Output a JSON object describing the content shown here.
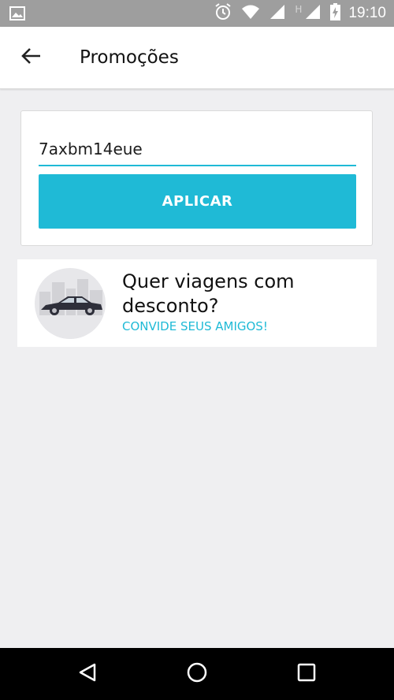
{
  "status_bar": {
    "time": "19:10",
    "network_label": "H",
    "icons": [
      "image-icon",
      "alarm-icon",
      "wifi-icon",
      "signal-icon",
      "signal-icon",
      "battery-charging-icon"
    ]
  },
  "header": {
    "title": "Promoções",
    "back_icon": "arrow-left-icon"
  },
  "promo": {
    "code_value": "7axbm14eue",
    "apply_label": "APLICAR"
  },
  "invite": {
    "heading": "Quer viagens com desconto?",
    "link_label": "CONVIDE SEUS AMIGOS!",
    "illustration": "car-city-illustration"
  },
  "nav": {
    "icons": [
      "back-triangle-icon",
      "home-circle-icon",
      "recents-square-icon"
    ]
  },
  "colors": {
    "accent": "#1fbad6",
    "background": "#efeff1",
    "status_bar": "#9e9e9e",
    "nav_bar": "#000000"
  }
}
